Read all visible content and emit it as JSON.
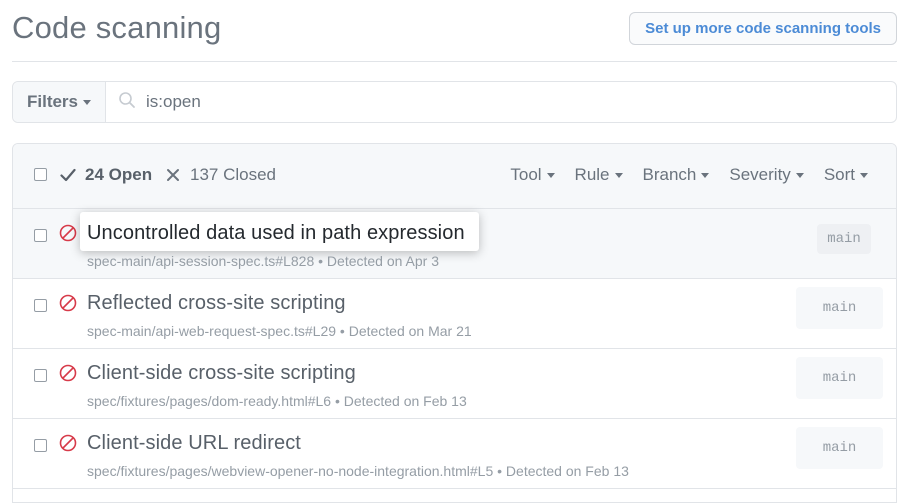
{
  "header": {
    "title": "Code scanning",
    "setup_button": "Set up more code scanning tools"
  },
  "filterbar": {
    "filters_label": "Filters",
    "search_value": "is:open"
  },
  "list_header": {
    "open_label": "24 Open",
    "closed_label": "137 Closed",
    "filters": [
      "Tool",
      "Rule",
      "Branch",
      "Severity",
      "Sort"
    ]
  },
  "alerts": [
    {
      "title": "Uncontrolled data used in path expression",
      "path": "spec-main/api-session-spec.ts#L828",
      "detected": "Detected on Apr 3",
      "branch": "main"
    },
    {
      "title": "Reflected cross-site scripting",
      "path": "spec-main/api-web-request-spec.ts#L29",
      "detected": "Detected on Mar 21",
      "branch": "main"
    },
    {
      "title": "Client-side cross-site scripting",
      "path": "spec/fixtures/pages/dom-ready.html#L6",
      "detected": "Detected on Feb 13",
      "branch": "main"
    },
    {
      "title": "Client-side URL redirect",
      "path": "spec/fixtures/pages/webview-opener-no-node-integration.html#L5",
      "detected": "Detected on Feb 13",
      "branch": "main"
    }
  ],
  "colors": {
    "accent": "#4c8bd6",
    "alert_icon": "#d73a49",
    "muted": "#6a737d"
  },
  "icons": {
    "search": "search-icon",
    "check": "check-icon",
    "x": "x-icon",
    "alert": "stop-icon"
  }
}
